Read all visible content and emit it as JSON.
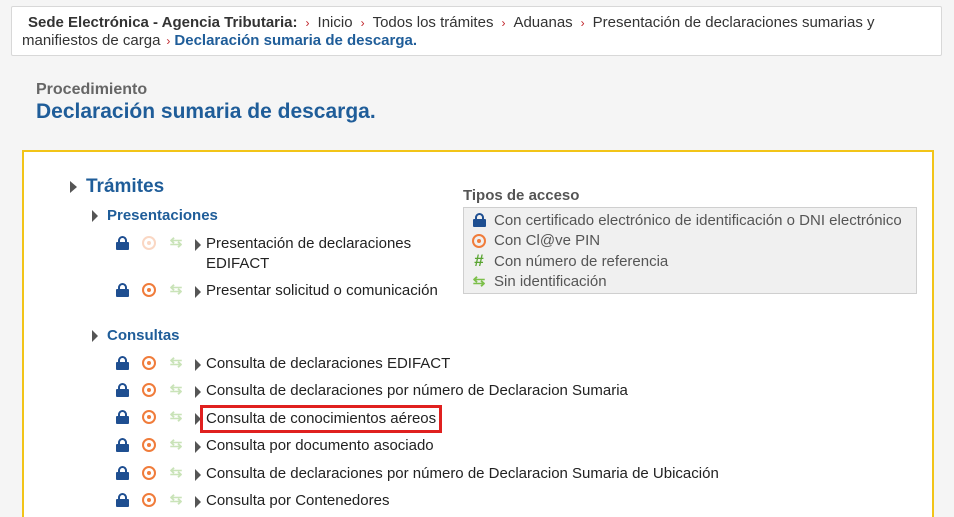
{
  "breadcrumb": {
    "head": "Sede Electrónica - Agencia Tributaria:",
    "items": [
      "Inicio",
      "Todos los trámites",
      "Aduanas",
      "Presentación de declaraciones sumarias y manifiestos de carga"
    ],
    "current": "Declaración sumaria de descarga."
  },
  "procedure": {
    "label": "Procedimiento",
    "title": "Declaración sumaria de descarga."
  },
  "tramites": {
    "title": "Trámites",
    "presentaciones": {
      "title": "Presentaciones",
      "items": [
        {
          "label": "Presentación de declaraciones EDIFACT"
        },
        {
          "label": "Presentar solicitud o comunicación"
        }
      ]
    },
    "consultas": {
      "title": "Consultas",
      "items": [
        {
          "label": "Consulta de declaraciones EDIFACT"
        },
        {
          "label": "Consulta de declaraciones por número de Declaracion Sumaria"
        },
        {
          "label": "Consulta de conocimientos aéreos"
        },
        {
          "label": "Consulta por documento asociado"
        },
        {
          "label": "Consulta de declaraciones por número de Declaracion Sumaria de Ubicación"
        },
        {
          "label": "Consulta por Contenedores"
        }
      ]
    }
  },
  "access": {
    "title": "Tipos de acceso",
    "items": [
      {
        "icon": "lock-icon",
        "label": "Con certificado electrónico de identificación o DNI electrónico"
      },
      {
        "icon": "clave-pin-icon",
        "label": "Con Cl@ve PIN"
      },
      {
        "icon": "hash-icon",
        "label": "Con número de referencia"
      },
      {
        "icon": "exchange-arrows-icon",
        "label": "Sin identificación"
      }
    ]
  },
  "colors": {
    "link_blue": "#1f5d99",
    "panel_border": "#f2c418",
    "highlight": "#e0201f"
  }
}
